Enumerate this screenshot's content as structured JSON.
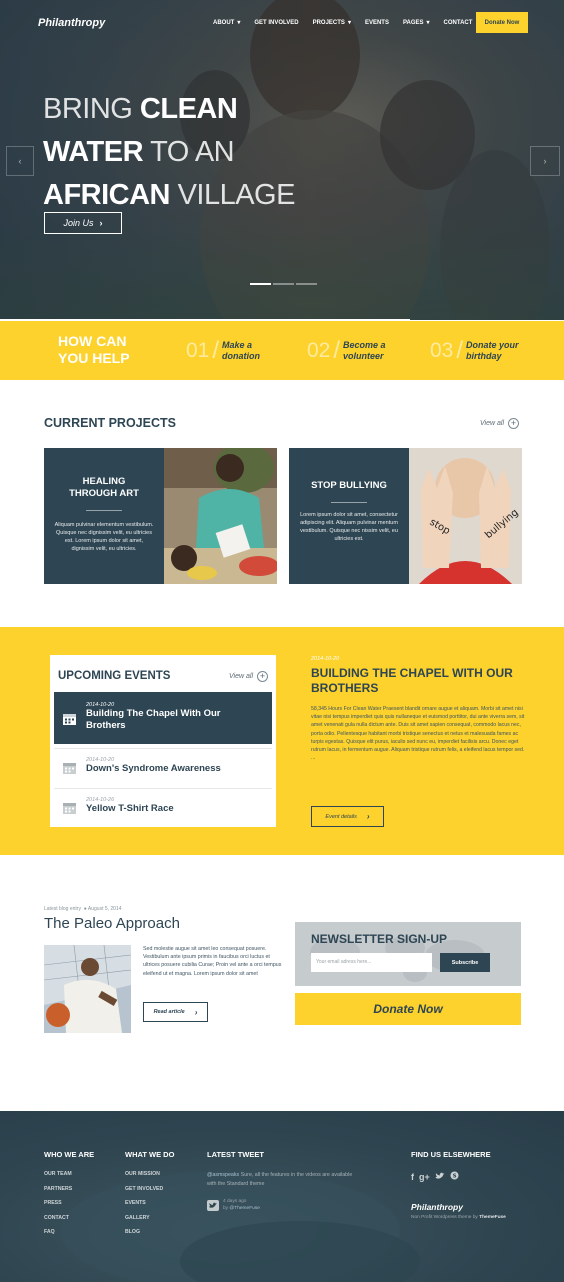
{
  "header": {
    "logo": "Philanthropy",
    "nav": [
      {
        "label": "ABOUT",
        "has_menu": true
      },
      {
        "label": "GET INVOLVED",
        "has_menu": false
      },
      {
        "label": "PROJECTS",
        "has_menu": true
      },
      {
        "label": "EVENTS",
        "has_menu": false
      },
      {
        "label": "PAGES",
        "has_menu": true
      },
      {
        "label": "CONTACT",
        "has_menu": false
      }
    ],
    "donate_label": "Donate Now"
  },
  "hero": {
    "line1_thin": "BRING",
    "line1_bold": "CLEAN",
    "line2_bold": "WATER",
    "line2_thin": "TO AN",
    "line3_bold": "AFRICAN",
    "line3_thin": "VILLAGE",
    "cta_label": "Join Us",
    "slides": 3,
    "active_slide": 1
  },
  "help": {
    "title_line1": "HOW CAN",
    "title_line2": "YOU HELP",
    "steps": [
      {
        "num": "01",
        "line1": "Make a",
        "line2": "donation"
      },
      {
        "num": "02",
        "line1": "Become a",
        "line2": "volunteer"
      },
      {
        "num": "03",
        "line1": "Donate your",
        "line2": "birthday"
      }
    ]
  },
  "projects": {
    "title": "CURRENT PROJECTS",
    "view_all": "View all",
    "items": [
      {
        "title_line1": "HEALING",
        "title_line2": "THROUGH ART",
        "text": "Aliquam pulvinar elementum vestibulum. Quisque nec dignissim velit, eu ultricies est. Lorem ipsum dolor sit amet, dignissim velit, eu ultricies."
      },
      {
        "title_line1": "STOP BULLYING",
        "title_line2": "",
        "text": "Lorem ipsum dolor sit amet, consectetur adipiscing elit. Aliquam pulvinar mentum vestibulum. Quisque nec nissim velit, eu ultricies est."
      }
    ]
  },
  "events": {
    "title": "UPCOMING EVENTS",
    "view_all": "View all",
    "list": [
      {
        "date": "2014-10-20",
        "name_line1": "Building The Chapel With Our",
        "name_line2": "Brothers"
      },
      {
        "date": "2014-10-20",
        "name_line1": "Down's Syndrome Awareness",
        "name_line2": ""
      },
      {
        "date": "2014-10-26",
        "name_line1": "Yellow T-Shirt Race",
        "name_line2": ""
      }
    ],
    "featured": {
      "date": "2014-10-20",
      "title": "BUILDING THE CHAPEL WITH OUR BROTHERS",
      "text": "58,345 Hours For Clean Water Praesent blandit ornare augue et aliquam. Morbi sit amet nisi vitae nisi tempus imperdiet quis quis nullaneque et euismod porttitor, dui ante viverra sem, sit amet venenati gula nulla dictum ante. Duis sit amet sapien consequat, commodo lacus nec, porta odio. Pellentesque habitant morbi tristique senectus et netus et malesuada fames ac turpis egestas. Quisque elit purus, iaculis sed nunc eu, imperdiet facilisis arcu. Donec eget rutrum lacus, in fermentum augue. Aliquam tristique rutrum felis, a eleifend lacus tempor sed. ...",
      "button": "Event details"
    }
  },
  "blog": {
    "meta_label": "Latest blog entry",
    "meta_date": "August 5, 2014",
    "title": "The Paleo Approach",
    "text": "Sed molestie augue sit amet leo consequat posuere. Vestibulum ante ipsum primis in faucibus orci luctus et ultrices posuere cubilia Curae; Proin vel ante a orci tempus eleifend ut et magna. Lorem ipsum dolor sit amet",
    "button": "Read article"
  },
  "newsletter": {
    "title": "NEWSLETTER SIGN-UP",
    "placeholder": "Your email adress here...",
    "button": "Subscribe"
  },
  "donate_big": "Donate Now",
  "footer": {
    "col1": {
      "title": "WHO WE ARE",
      "links": [
        "OUR TEAM",
        "PARTNERS",
        "PRESS",
        "CONTACT",
        "FAQ"
      ]
    },
    "col2": {
      "title": "WHAT WE DO",
      "links": [
        "OUR MISSION",
        "GET INVOLVED",
        "EVENTS",
        "GALLERY",
        "BLOG"
      ]
    },
    "tweet": {
      "title": "LATEST TWEET",
      "handle": "@asmspeaks",
      "text": "Sure, all the features in the videos are available with the Standard theme",
      "time": "4 days ago",
      "by_prefix": "by",
      "by": "@ThemeFuse"
    },
    "social": {
      "title": "FIND US ELSEWHERE",
      "icons": [
        "facebook-icon",
        "google-plus-icon",
        "twitter-icon",
        "skype-icon"
      ]
    },
    "brand": "Philanthropy",
    "brand_sub": "Non Profit Wordpress theme by",
    "brand_by": "ThemeFuse"
  },
  "colors": {
    "accent": "#fdd22c",
    "navy": "#2e4553"
  }
}
